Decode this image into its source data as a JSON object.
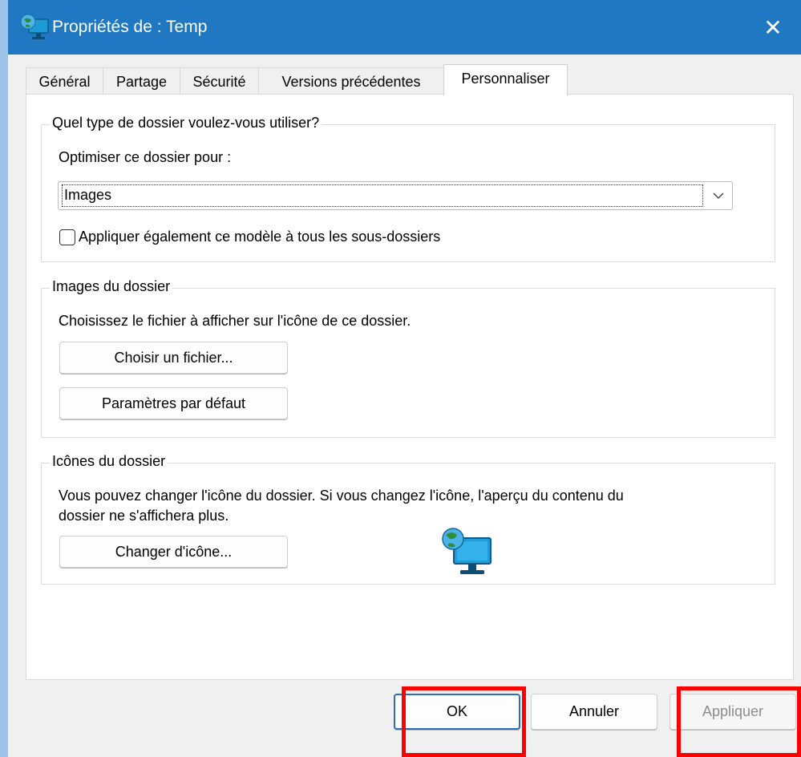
{
  "window": {
    "title": "Propriétés de : Temp",
    "close_glyph": "✕"
  },
  "tabs": [
    {
      "label": "Général"
    },
    {
      "label": "Partage"
    },
    {
      "label": "Sécurité"
    },
    {
      "label": "Versions précédentes"
    },
    {
      "label": "Personnaliser",
      "active": true
    }
  ],
  "folder_type": {
    "legend": "Quel type de dossier voulez-vous utiliser?",
    "optimize_label": "Optimiser ce dossier pour :",
    "optimize_value": "Images",
    "apply_subfolders_label": "Appliquer également ce modèle à tous les sous-dossiers",
    "apply_subfolders_checked": false
  },
  "folder_images": {
    "legend": "Images du dossier",
    "description": "Choisissez le fichier à afficher sur l'icône de ce dossier.",
    "choose_file_button": "Choisir un fichier...",
    "default_settings_button": "Paramètres par défaut"
  },
  "folder_icons": {
    "legend": "Icônes du dossier",
    "description_line1": "Vous pouvez changer l'icône du dossier. Si vous changez l'icône, l'aperçu du contenu du",
    "description_line2": "dossier ne s'affichera plus.",
    "change_icon_button": "Changer d'icône...",
    "preview_icon": "network-monitor-icon"
  },
  "footer": {
    "ok_label": "OK",
    "cancel_label": "Annuler",
    "apply_label": "Appliquer",
    "apply_enabled": false
  },
  "colors": {
    "titlebar": "#1f78c1",
    "highlight": "#ff0000",
    "default_button_border": "#2a6dc1"
  }
}
